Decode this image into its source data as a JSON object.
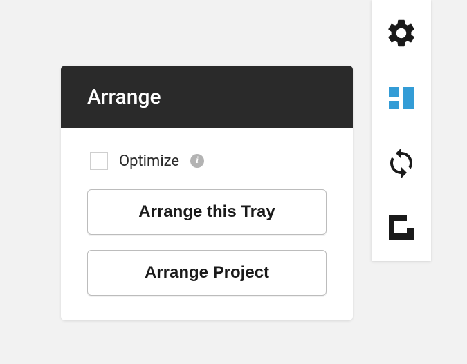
{
  "panel": {
    "title": "Arrange",
    "optimize_label": "Optimize",
    "arrange_tray_label": "Arrange this Tray",
    "arrange_project_label": "Arrange Project"
  },
  "sidebar": {
    "active_index": 1,
    "icons": [
      {
        "name": "settings-icon"
      },
      {
        "name": "arrange-icon"
      },
      {
        "name": "refresh-icon"
      },
      {
        "name": "export-icon"
      }
    ]
  },
  "colors": {
    "accent": "#339cd6",
    "panel_header_bg": "#2a2a2a"
  }
}
